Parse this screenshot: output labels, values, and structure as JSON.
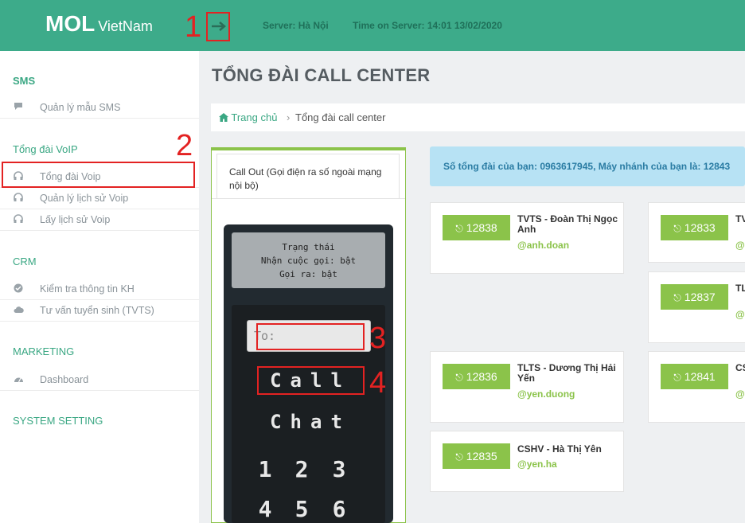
{
  "header": {
    "logo_main": "MOL",
    "logo_sub": "VietNam",
    "toggle_icon": "arrow-right-icon",
    "server": "Server: Hà Nội",
    "time": "Time on Server: 14:01 13/02/2020"
  },
  "sidebar": {
    "sections": [
      {
        "title": "SMS",
        "items": [
          {
            "label": "Quản lý mẫu SMS",
            "icon": "comment-icon"
          }
        ]
      },
      {
        "title": "Tổng đài VoIP",
        "items": [
          {
            "label": "Tổng đài Voip",
            "icon": "headphones-icon"
          },
          {
            "label": "Quản lý lịch sử Voip",
            "icon": "headphones-icon"
          },
          {
            "label": "Lấy lịch sử Voip",
            "icon": "headphones-icon"
          }
        ]
      },
      {
        "title": "CRM",
        "items": [
          {
            "label": "Kiểm tra thông tin KH",
            "icon": "check-circle-icon"
          },
          {
            "label": "Tư vấn tuyển sinh (TVTS)",
            "icon": "cloud-icon"
          }
        ]
      },
      {
        "title": "MARKETING",
        "items": [
          {
            "label": "Dashboard",
            "icon": "dashboard-icon"
          }
        ]
      },
      {
        "title": "SYSTEM SETTING",
        "items": []
      }
    ]
  },
  "page": {
    "title": "TỔNG ĐÀI CALL CENTER",
    "breadcrumb_home": "Trang chủ",
    "breadcrumb_sep": "›",
    "breadcrumb_current": "Tổng đài call center"
  },
  "callout": {
    "tab_label": "Call Out (Gọi điện ra số ngoài mạng nội bộ)",
    "status_title": "Trạng thái",
    "status_in": "Nhận cuộc gọi: bật",
    "status_out": "Gọi ra: bật",
    "to_placeholder": "To:",
    "call_label": "Call",
    "chat_label": "Chat",
    "keys": [
      "1",
      "2",
      "3",
      "4",
      "5",
      "6"
    ]
  },
  "info": {
    "text": "Số tổng đài của bạn: 0963617945, Máy nhánh của bạn là: 12843"
  },
  "extensions": [
    {
      "ext": "12838",
      "name": "TVTS - Đoàn Thị Ngọc Anh",
      "user": "@anh.doan"
    },
    {
      "ext": "12833",
      "name": "TV",
      "user": "@"
    },
    {
      "ext": "12837",
      "name": "TL Th",
      "user": "@"
    },
    {
      "ext": "12836",
      "name": "TLTS - Dương Thị Hải Yến",
      "user": "@yen.duong"
    },
    {
      "ext": "12841",
      "name": "CS Hồ",
      "user": "@"
    },
    {
      "ext": "12835",
      "name": "CSHV - Hà Thị Yên",
      "user": "@yen.ha"
    }
  ],
  "annotations": [
    "1",
    "2",
    "3",
    "4"
  ],
  "colors": {
    "header": "#3dab8a",
    "accent": "#8bc34a",
    "info_bg": "#b7e2f4",
    "annotation": "#e32222"
  }
}
